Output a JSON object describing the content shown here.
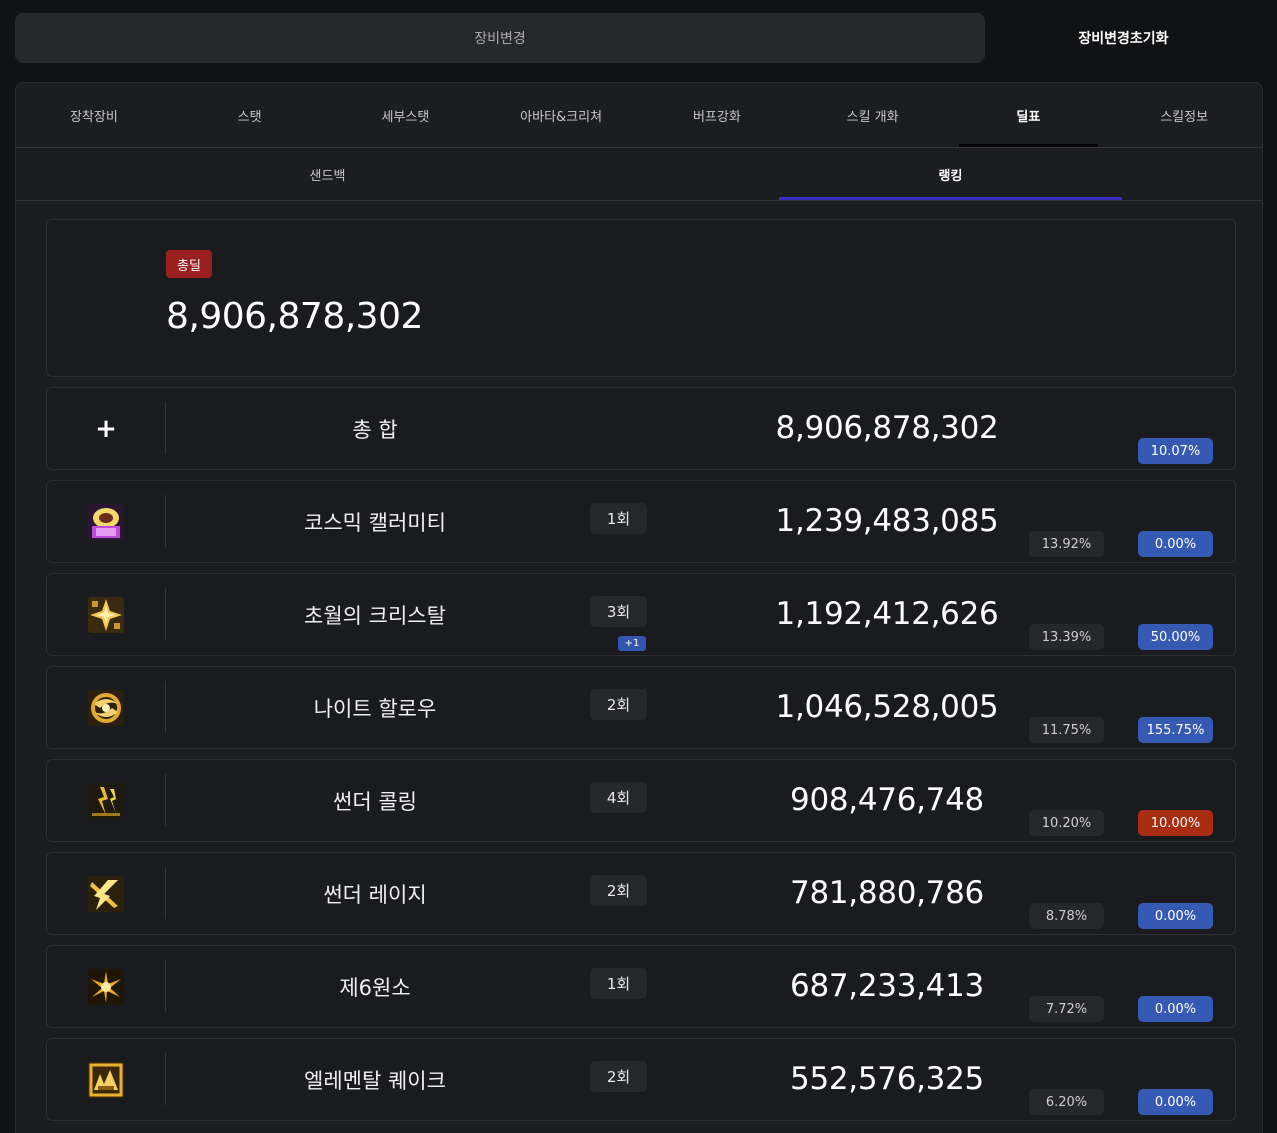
{
  "top_bar": {
    "change_equipment": "장비변경",
    "reset_equipment": "장비변경초기화"
  },
  "main_tabs": [
    {
      "label": "장착장비"
    },
    {
      "label": "스탯"
    },
    {
      "label": "세부스탯"
    },
    {
      "label": "아바타&크리쳐"
    },
    {
      "label": "버프강화"
    },
    {
      "label": "스킬 개화"
    },
    {
      "label": "딜표"
    },
    {
      "label": "스킬정보"
    }
  ],
  "main_active_tab": "딜표",
  "sub_tabs": [
    {
      "label": "샌드백"
    },
    {
      "label": "랭킹"
    }
  ],
  "sub_active_tab": "랭킹",
  "total": {
    "badge": "총딜",
    "value": "8,906,878,302"
  },
  "summary_row": {
    "icon": "plus-icon",
    "plus_glyph": "+",
    "name": "총 합",
    "damage": "8,906,878,302",
    "buff": "10.07%"
  },
  "skills": [
    {
      "icon": "cosmic-calamity-icon",
      "name": "코스믹 캘러미티",
      "count": "1회",
      "damage": "1,239,483,085",
      "share": "13.92%",
      "buff": "0.00%",
      "buff_color": "blue"
    },
    {
      "icon": "transcendent-crystal-icon",
      "name": "초월의 크리스탈",
      "count": "3회",
      "count_extra": "+1",
      "damage": "1,192,412,626",
      "share": "13.39%",
      "buff": "50.00%",
      "buff_color": "blue"
    },
    {
      "icon": "night-hollow-icon",
      "name": "나이트 할로우",
      "count": "2회",
      "damage": "1,046,528,005",
      "share": "11.75%",
      "buff": "155.75%",
      "buff_color": "blue"
    },
    {
      "icon": "thunder-calling-icon",
      "name": "썬더 콜링",
      "count": "4회",
      "damage": "908,476,748",
      "share": "10.20%",
      "buff": "10.00%",
      "buff_color": "red"
    },
    {
      "icon": "thunder-rage-icon",
      "name": "썬더 레이지",
      "count": "2회",
      "damage": "781,880,786",
      "share": "8.78%",
      "buff": "0.00%",
      "buff_color": "blue"
    },
    {
      "icon": "sixth-element-icon",
      "name": "제6원소",
      "count": "1회",
      "damage": "687,233,413",
      "share": "7.72%",
      "buff": "0.00%",
      "buff_color": "blue"
    },
    {
      "icon": "elemental-quake-icon",
      "name": "엘레멘탈 퀘이크",
      "count": "2회",
      "damage": "552,576,325",
      "share": "6.20%",
      "buff": "0.00%",
      "buff_color": "blue"
    }
  ],
  "colors": {
    "background": "#111214",
    "panel": "#1c1d20",
    "total_badge": "#9a1f1f",
    "buff_blue": "#3659b3",
    "buff_red": "#a82d12",
    "count_extra": "#3556b0",
    "sub_tab_underline": "#3a2cc0"
  }
}
